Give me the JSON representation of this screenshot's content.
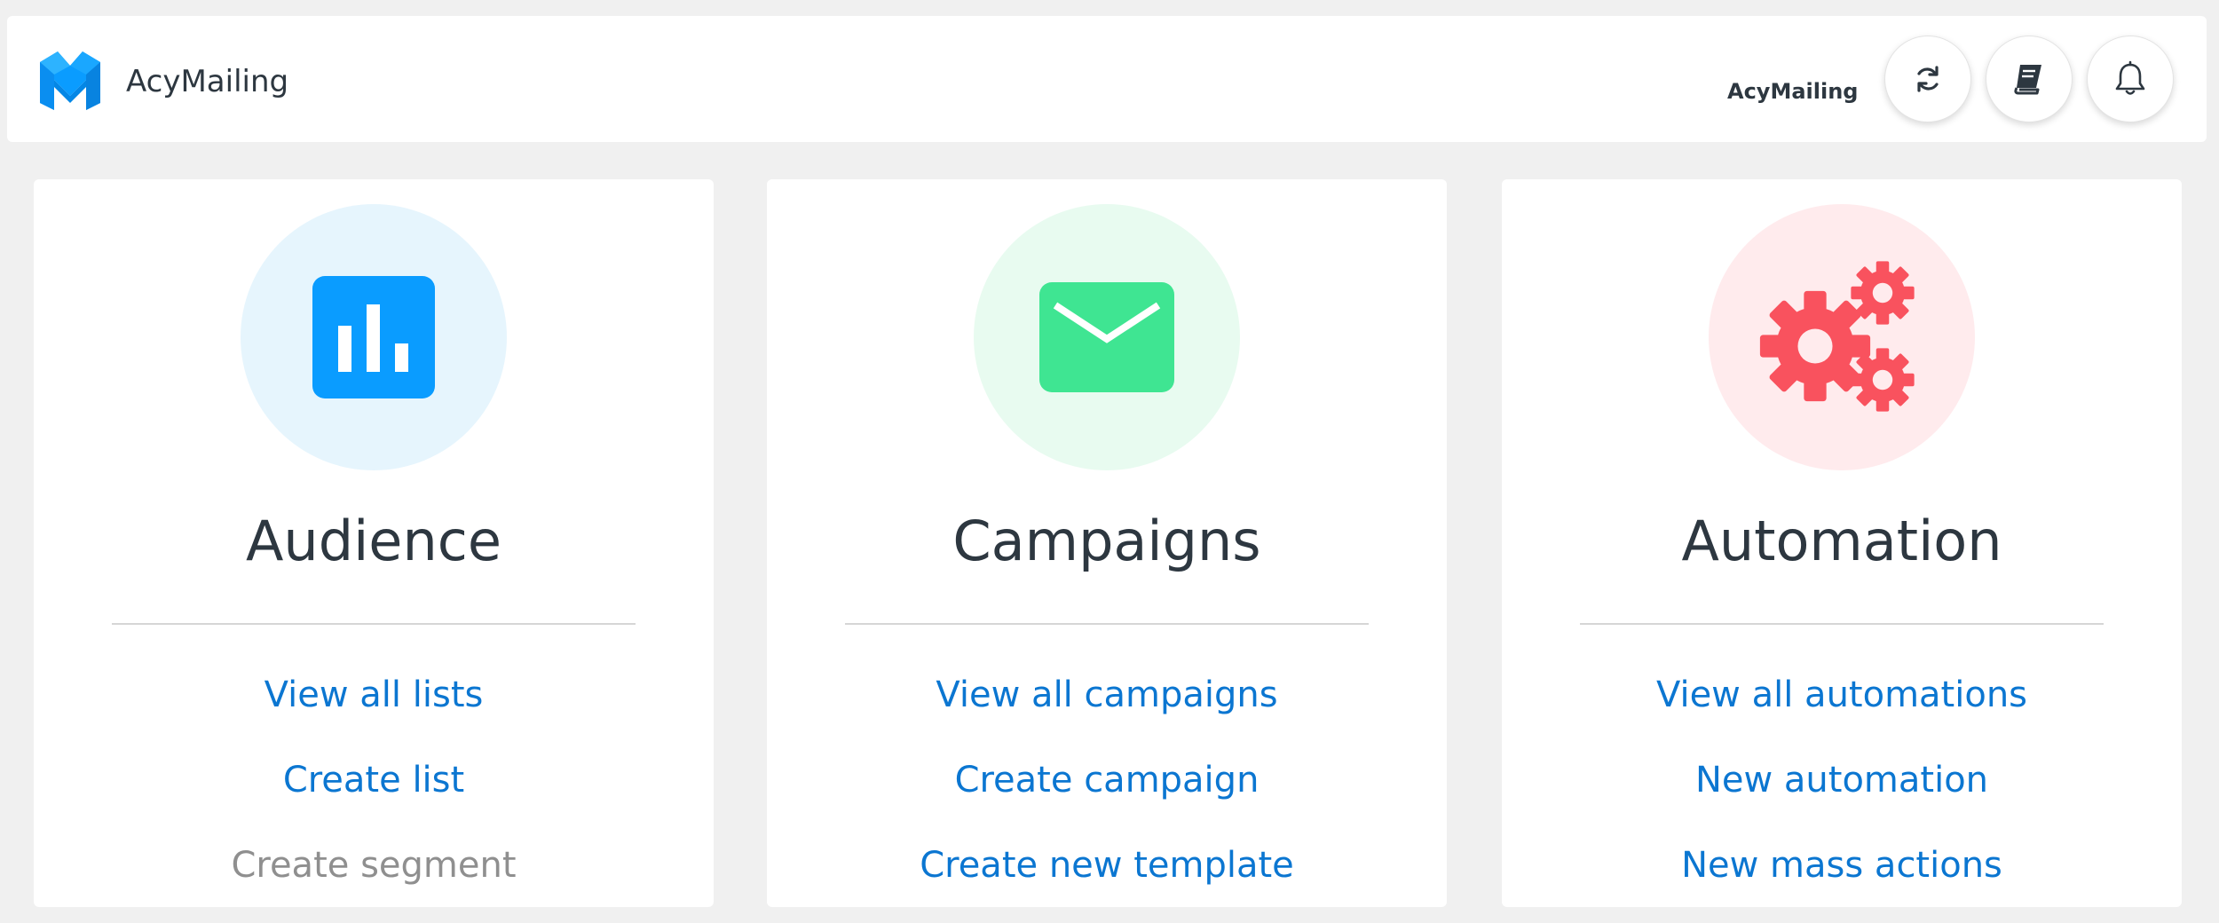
{
  "header": {
    "brand": "AcyMailing",
    "right_label": "AcyMailing",
    "buttons": [
      {
        "name": "refresh",
        "icon": "refresh-icon"
      },
      {
        "name": "documentation",
        "icon": "book-icon"
      },
      {
        "name": "notifications",
        "icon": "bell-icon"
      }
    ]
  },
  "colors": {
    "link": "#0b76d1",
    "audience_accent": "#0a9cff",
    "audience_bg": "#e6f5fd",
    "campaigns_accent": "#3fe592",
    "campaigns_bg": "#e8fbf0",
    "automation_accent": "#f9525e",
    "automation_bg": "#ffebed"
  },
  "cards": {
    "audience": {
      "icon": "bar-chart-icon",
      "title": "Audience",
      "links": [
        "View all lists",
        "Create list",
        "Create segment"
      ]
    },
    "campaigns": {
      "icon": "envelope-icon",
      "title": "Campaigns",
      "links": [
        "View all campaigns",
        "Create campaign",
        "Create new template"
      ]
    },
    "automation": {
      "icon": "gears-icon",
      "title": "Automation",
      "links": [
        "View all automations",
        "New automation",
        "New mass actions"
      ]
    }
  }
}
